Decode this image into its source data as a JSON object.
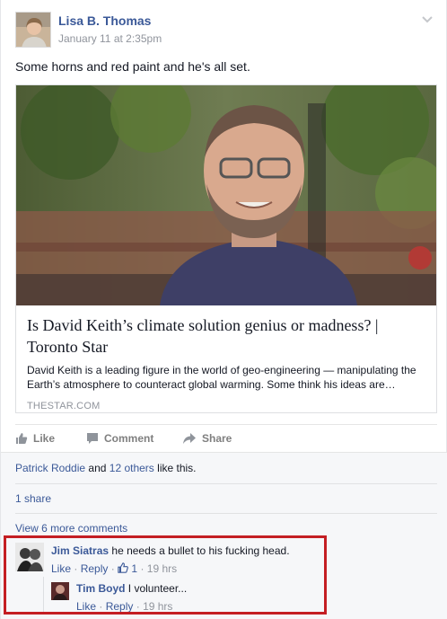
{
  "post": {
    "author": "Lisa B. Thomas",
    "timestamp": "January 11 at 2:35pm",
    "text": "Some horns and red paint and he's all set."
  },
  "link_card": {
    "title": "Is David Keith’s climate solution genius or madness? | Toronto Star",
    "description": "David Keith is a leading figure in the world of geo-engineering — manipulating the Earth’s atmosphere to counteract global warming. Some think his ideas are…",
    "source": "THESTAR.COM"
  },
  "actions": {
    "like": "Like",
    "comment": "Comment",
    "share": "Share"
  },
  "likes": {
    "name": "Patrick Roddie",
    "and": "and",
    "others": "12 others",
    "suffix": "like this."
  },
  "shares": "1 share",
  "view_more": "View 6 more comments",
  "comments": [
    {
      "author": "Jim Siatras",
      "text": "he needs a bullet to his fucking head.",
      "like": "Like",
      "reply": "Reply",
      "reactions": "1",
      "time": "19 hrs"
    },
    {
      "author": "Tim Boyd",
      "text": "I volunteer...",
      "like": "Like",
      "reply": "Reply",
      "time": "19 hrs"
    }
  ],
  "colors": {
    "link_blue": "#3b5998",
    "highlight_red": "#c41e23",
    "muted_gray": "#90949c"
  }
}
